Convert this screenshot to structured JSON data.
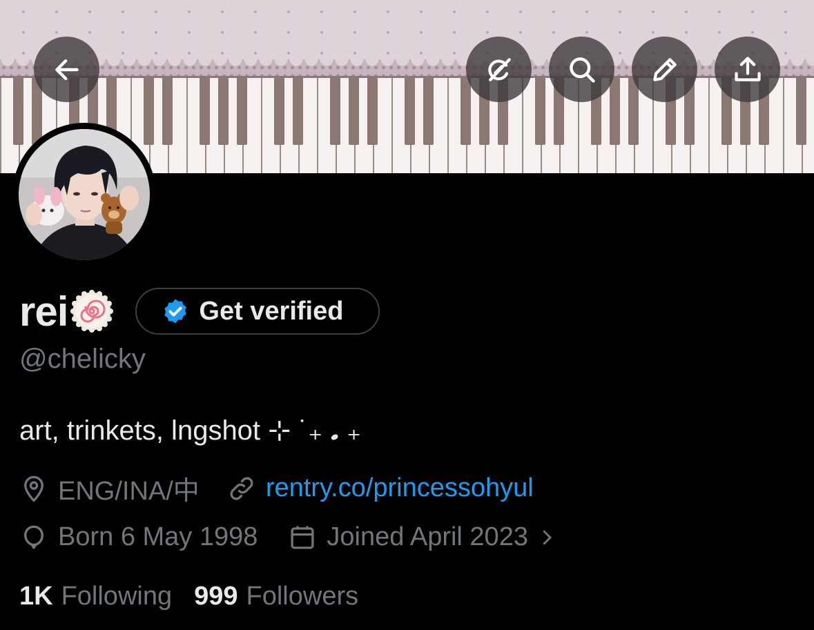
{
  "header": {
    "back_icon": "arrow-left-icon",
    "actions": [
      "grok-icon",
      "search-icon",
      "pencil-icon",
      "share-icon"
    ]
  },
  "profile": {
    "display_name": "rei",
    "name_emoji": "narutomaki-icon",
    "verify_button_label": "Get verified",
    "handle": "@chelicky",
    "bio": "art, trinkets, lngshot ⊹ ˙₊ 𝅘 ₊",
    "location": "ENG/INA/中",
    "website": "rentry.co/princessohyul",
    "birthday": "Born 6 May 1998",
    "joined": "Joined April 2023",
    "following_count": "1K",
    "following_label": "Following",
    "followers_count": "999",
    "followers_label": "Followers"
  },
  "colors": {
    "background": "#000000",
    "text_primary": "#e7e9ea",
    "text_secondary": "#71767b",
    "link": "#1d9bf0",
    "verified": "#1d9bf0"
  }
}
